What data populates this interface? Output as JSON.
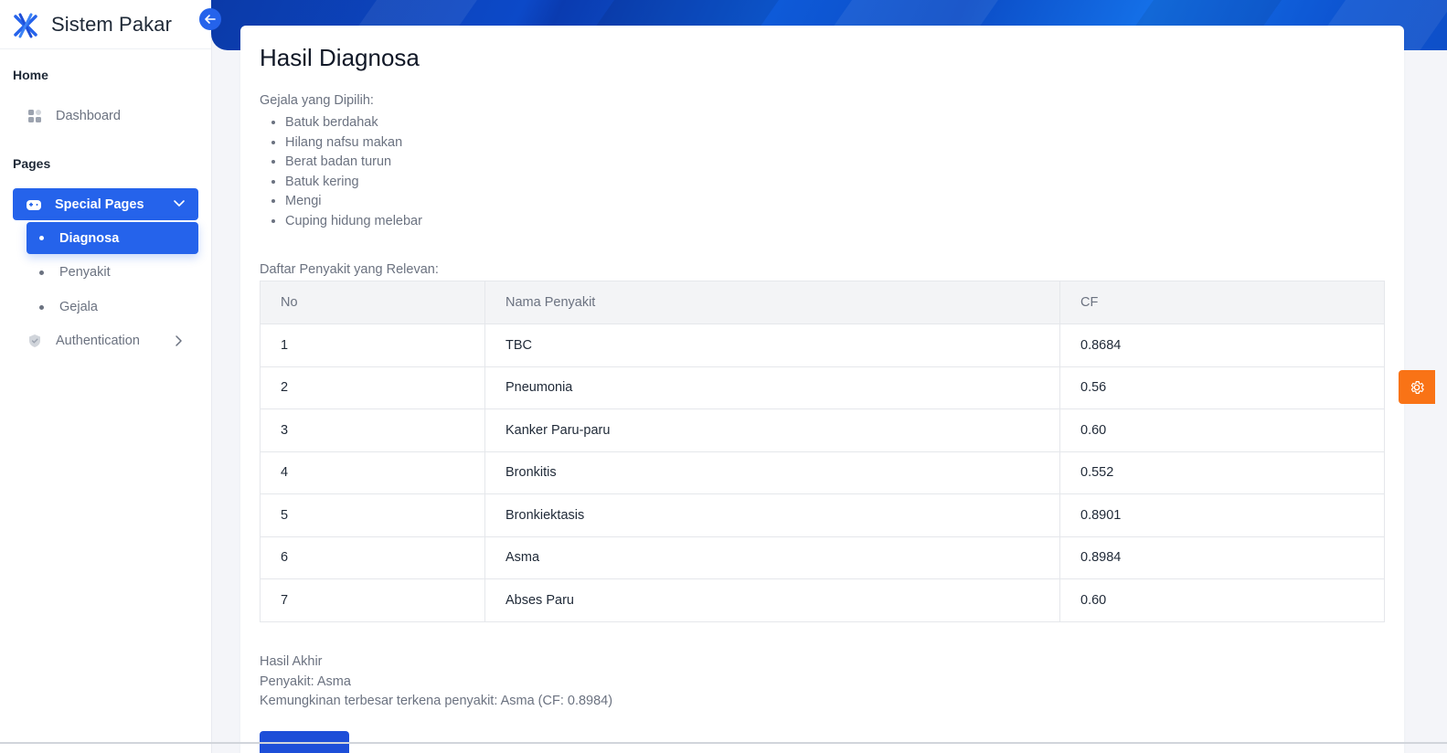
{
  "app": {
    "title": "Sistem Pakar"
  },
  "sidebar": {
    "sections": [
      {
        "label": "Home"
      },
      {
        "label": "Pages"
      }
    ],
    "dashboard": {
      "label": "Dashboard",
      "icon": "grid-icon"
    },
    "special_pages": {
      "label": "Special Pages",
      "icon": "game-pad-icon",
      "expanded": true
    },
    "sub_items": [
      {
        "label": "Diagnosa",
        "active": true
      },
      {
        "label": "Penyakit",
        "active": false
      },
      {
        "label": "Gejala",
        "active": false
      }
    ],
    "authentication": {
      "label": "Authentication",
      "icon": "shield-icon"
    }
  },
  "main": {
    "title": "Hasil Diagnosa",
    "symptoms_label": "Gejala yang Dipilih:",
    "symptoms": [
      "Batuk berdahak",
      "Hilang nafsu makan",
      "Berat badan turun",
      "Batuk kering",
      "Mengi",
      "Cuping hidung melebar"
    ],
    "table_label": "Daftar Penyakit yang Relevan:",
    "table": {
      "headers": [
        "No",
        "Nama Penyakit",
        "CF"
      ],
      "rows": [
        [
          "1",
          "TBC",
          "0.8684"
        ],
        [
          "2",
          "Pneumonia",
          "0.56"
        ],
        [
          "3",
          "Kanker Paru-paru",
          "0.60"
        ],
        [
          "4",
          "Bronkitis",
          "0.552"
        ],
        [
          "5",
          "Bronkiektasis",
          "0.8901"
        ],
        [
          "6",
          "Asma",
          "0.8984"
        ],
        [
          "7",
          "Abses Paru",
          "0.60"
        ]
      ]
    },
    "result": {
      "heading": "Hasil Akhir",
      "disease": "Penyakit: Asma",
      "summary": "Kemungkinan terbesar terkena penyakit: Asma (CF: 0.8984)"
    },
    "button_label": ""
  },
  "colors": {
    "primary": "#2563eb",
    "settings_fab": "#f97316",
    "banner": "#0e5ad8"
  }
}
